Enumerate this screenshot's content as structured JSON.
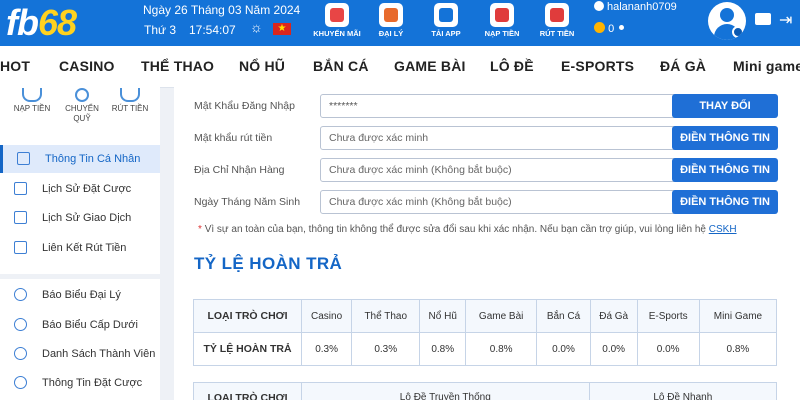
{
  "header": {
    "logo_main": "fb",
    "logo_accent": "68",
    "date": "Ngày 26 Tháng 03 Năm 2024",
    "weekday": "Thứ 3",
    "time": "17:54:07",
    "buttons": [
      {
        "label": "KHUYẾN MÃI",
        "icon": "gift-icon",
        "color": "#e84545"
      },
      {
        "label": "ĐẠI LÝ",
        "icon": "handshake-icon",
        "color": "#e86a2c"
      },
      {
        "label": "TẢI APP",
        "icon": "download-app-icon",
        "color": "#1473d8"
      },
      {
        "label": "NẠP TIỀN",
        "icon": "deposit-icon",
        "color": "#e03c3c"
      },
      {
        "label": "RÚT TIỀN",
        "icon": "withdraw-icon",
        "color": "#e03c3c"
      }
    ],
    "username": "halananh0709",
    "balance": "0",
    "currency_symbol": "0"
  },
  "nav": {
    "items": [
      "HOT",
      "CASINO",
      "THỂ THAO",
      "NỔ HŨ",
      "BẮN CÁ",
      "GAME BÀI",
      "LÔ ĐỀ",
      "E-SPORTS",
      "ĐÁ GÀ",
      "Mini game"
    ]
  },
  "sidebar": {
    "quick": [
      {
        "label": "NẠP TIỀN",
        "icon": "deposit-icon"
      },
      {
        "label": "CHUYỂN QUỸ",
        "icon": "transfer-icon"
      },
      {
        "label": "RÚT TIỀN",
        "icon": "withdraw-icon"
      }
    ],
    "items": [
      {
        "label": "Thông Tin Cá Nhân",
        "icon": "profile-card-icon"
      },
      {
        "label": "Lịch Sử Đặt Cược",
        "icon": "bet-history-icon"
      },
      {
        "label": "Lịch Sử Giao Dịch",
        "icon": "transaction-history-icon"
      },
      {
        "label": "Liên Kết Rút Tiền",
        "icon": "bank-link-icon"
      },
      {
        "label": "Báo Biểu Đại Lý",
        "icon": "agent-report-icon"
      },
      {
        "label": "Báo Biểu Cấp Dưới",
        "icon": "subordinate-report-icon"
      },
      {
        "label": "Danh Sách Thành Viên",
        "icon": "member-list-icon"
      },
      {
        "label": "Thông Tin Đặt Cược",
        "icon": "bet-info-icon"
      }
    ]
  },
  "form": {
    "rows": [
      {
        "label": "Mật Khẩu Đăng Nhập",
        "value": "*******",
        "placeholder": "",
        "button": "THAY ĐỔI"
      },
      {
        "label": "Mật khẩu rút tiền",
        "value": "",
        "placeholder": "Chưa được xác minh",
        "button": "ĐIỀN THÔNG TIN"
      },
      {
        "label": "Địa Chỉ Nhận Hàng",
        "value": "",
        "placeholder": "Chưa được xác minh (Không bắt buộc)",
        "button": "ĐIỀN THÔNG TIN"
      },
      {
        "label": "Ngày Tháng Năm Sinh",
        "value": "",
        "placeholder": "Chưa được xác minh (Không bắt buộc)",
        "button": "ĐIỀN THÔNG TIN"
      }
    ],
    "note": "Vì sự an toàn của bạn, thông tin không thể được sửa đổi sau khi xác nhận. Nếu bạn cần trợ giúp, vui lòng liên hệ",
    "note_link": "CSKH",
    "button_color": "#1f6fd6"
  },
  "rebate": {
    "title": "TỶ LỆ HOÀN TRẢ",
    "header_label": "LOẠI TRÒ CHƠI",
    "row_label": "TỶ LỆ HOÀN TRẢ",
    "games": [
      "Casino",
      "Thể Thao",
      "Nổ Hũ",
      "Game Bài",
      "Bắn Cá",
      "Đá Gà",
      "E-Sports",
      "Mini Game"
    ],
    "rates": [
      "0.3%",
      "0.3%",
      "0.8%",
      "0.8%",
      "0.0%",
      "0.0%",
      "0.0%",
      "0.8%"
    ],
    "second_header_label": "LOẠI TRÒ CHƠI",
    "second_columns": [
      "Lô Đề Truyền Thống",
      "Lô Đề Nhanh"
    ]
  }
}
